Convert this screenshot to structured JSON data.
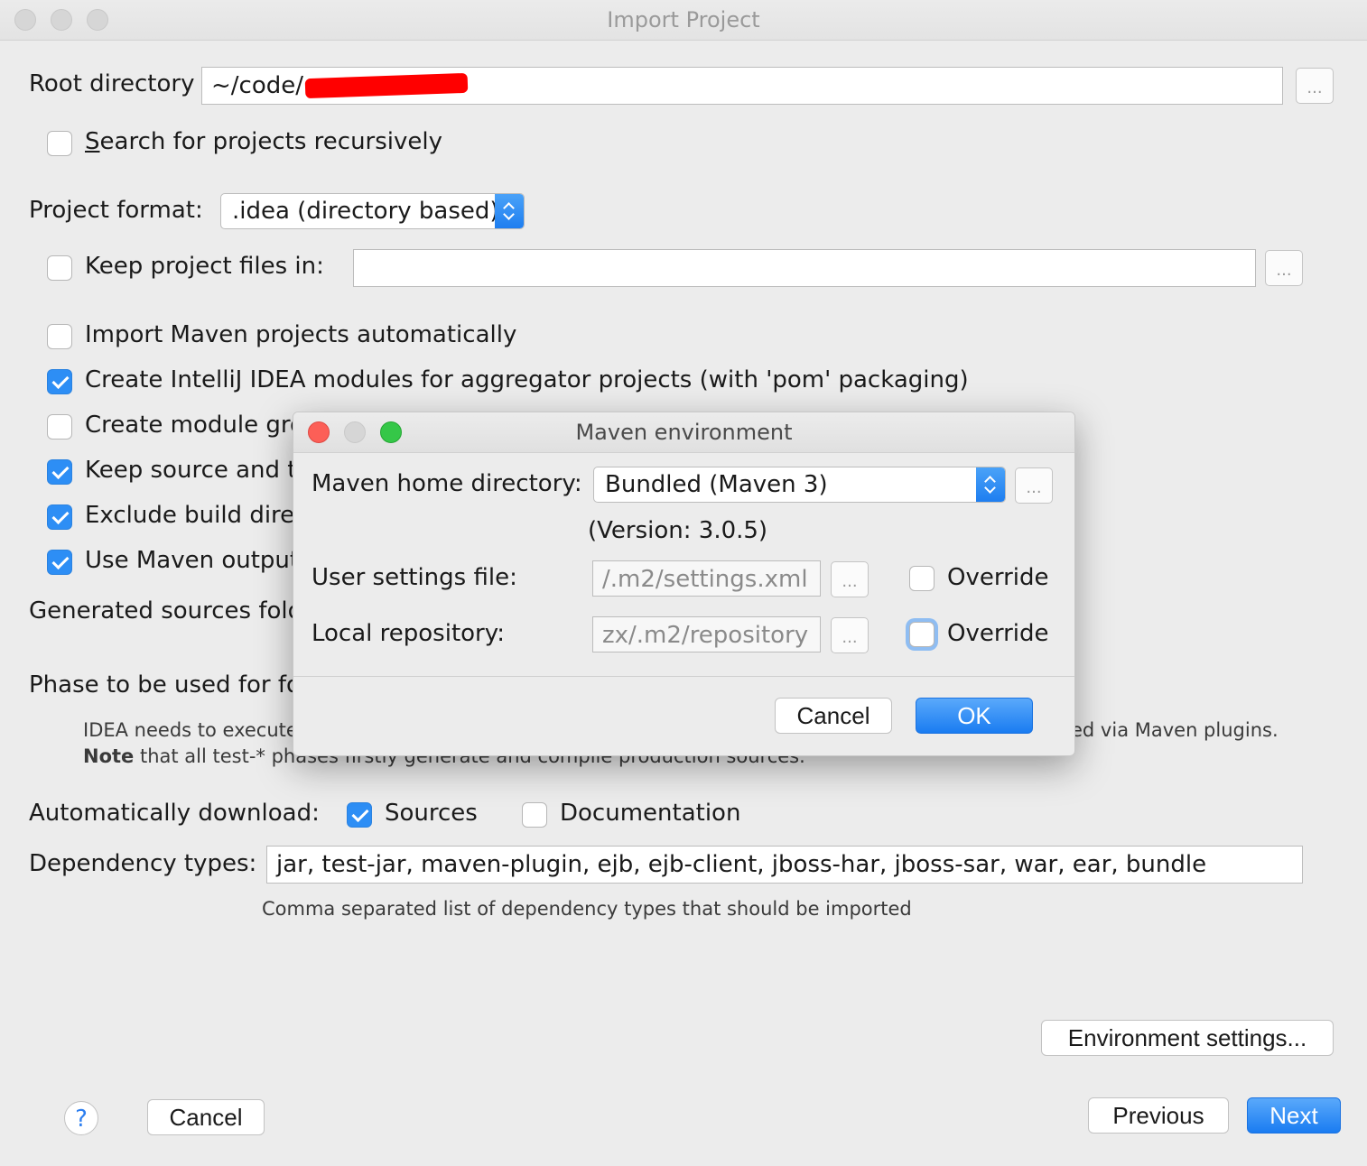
{
  "window": {
    "title": "Import Project"
  },
  "root_directory": {
    "label": "Root directory",
    "value": "~/code/",
    "browse": "..."
  },
  "search_recursively": {
    "label": "Search for projects recursively",
    "checked": false
  },
  "project_format": {
    "label": "Project format:",
    "selected": ".idea (directory based)"
  },
  "keep_project_files": {
    "label": "Keep project files in:",
    "value": "",
    "browse": "...",
    "checked": false
  },
  "options": [
    {
      "label": "Import Maven projects automatically",
      "checked": false
    },
    {
      "label": "Create IntelliJ IDEA modules for aggregator projects (with 'pom' packaging)",
      "checked": true
    },
    {
      "label": "Create module gro",
      "checked": false
    },
    {
      "label": "Keep source and te",
      "checked": true
    },
    {
      "label": "Exclude build dire",
      "checked": true
    },
    {
      "label": "Use Maven output",
      "checked": true
    }
  ],
  "generated_sources": {
    "label": "Generated sources fold"
  },
  "phase": {
    "label": "Phase to be used for fo",
    "note_line1_left": "IDEA needs to execute",
    "note_line1_right": "ed via Maven plugins.",
    "note_bold": "Note",
    "note_line2": " that all test-* phases firstly generate and compile production sources."
  },
  "auto_download": {
    "label": "Automatically download:",
    "sources_label": "Sources",
    "sources_checked": true,
    "documentation_label": "Documentation",
    "documentation_checked": false
  },
  "dependency_types": {
    "label": "Dependency types:",
    "value": "jar, test-jar, maven-plugin, ejb, ejb-client, jboss-har, jboss-sar, war, ear, bundle",
    "hint": "Comma separated list of dependency types that should be imported"
  },
  "footer": {
    "environment_settings": "Environment settings...",
    "help": "?",
    "cancel": "Cancel",
    "previous": "Previous",
    "next": "Next"
  },
  "maven_dialog": {
    "title": "Maven environment",
    "home_label": "Maven home directory:",
    "home_selected": "Bundled (Maven 3)",
    "home_browse": "...",
    "version": "(Version: 3.0.5)",
    "user_settings_label": "User settings file:",
    "user_settings_value": "/.m2/settings.xml",
    "user_settings_browse": "...",
    "user_settings_override": "Override",
    "local_repo_label": "Local repository:",
    "local_repo_value": "zx/.m2/repository",
    "local_repo_browse": "...",
    "local_repo_override": "Override",
    "cancel": "Cancel",
    "ok": "OK"
  },
  "colors": {
    "accent": "#2d8ef5",
    "background": "#ececec",
    "redaction": "#ff0000"
  }
}
